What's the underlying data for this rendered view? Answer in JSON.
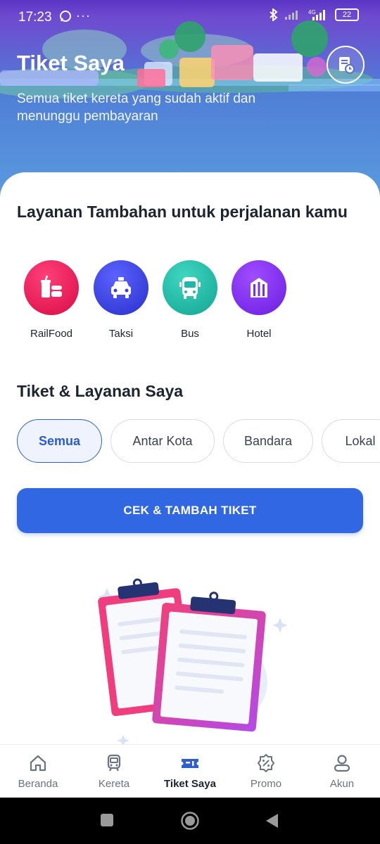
{
  "status_bar": {
    "time": "17:23",
    "more": "···",
    "battery": "22"
  },
  "header": {
    "title": "Tiket Saya",
    "subtitle": "Semua tiket kereta yang sudah aktif dan menunggu pembayaran",
    "history_icon": "ticket-history-icon"
  },
  "services": {
    "title": "Layanan Tambahan untuk perjalanan kamu",
    "items": [
      {
        "label": "RailFood",
        "icon": "food-icon",
        "color": "#e5124e"
      },
      {
        "label": "Taksi",
        "icon": "taxi-icon",
        "color": "#3b3fd9"
      },
      {
        "label": "Bus",
        "icon": "bus-icon",
        "color": "#1fb8a6"
      },
      {
        "label": "Hotel",
        "icon": "hotel-icon",
        "color": "#7b2fe0"
      }
    ]
  },
  "tickets": {
    "title": "Tiket & Layanan Saya",
    "filters": [
      "Semua",
      "Antar Kota",
      "Bandara",
      "Lokal"
    ],
    "active_filter": "Semua",
    "cta": "CEK & TAMBAH TIKET"
  },
  "bottom_nav": {
    "items": [
      {
        "label": "Beranda",
        "icon": "home-icon"
      },
      {
        "label": "Kereta",
        "icon": "train-icon"
      },
      {
        "label": "Tiket Saya",
        "icon": "ticket-icon"
      },
      {
        "label": "Promo",
        "icon": "promo-icon"
      },
      {
        "label": "Akun",
        "icon": "account-icon"
      }
    ],
    "active": "Tiket Saya"
  },
  "colors": {
    "primary": "#3267e3",
    "header_top": "#5a35c4",
    "header_bottom": "#5b9be0"
  }
}
